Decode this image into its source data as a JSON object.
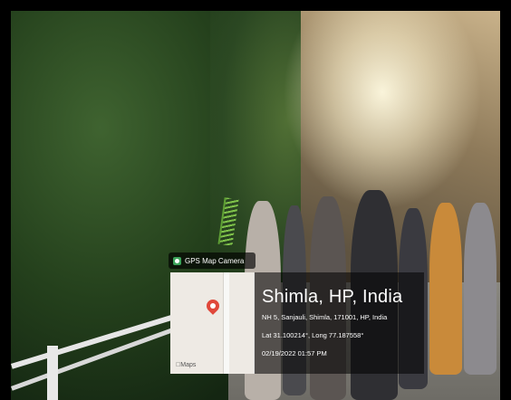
{
  "photo": {
    "description_tag": "outdoor-group-photo"
  },
  "gps_overlay": {
    "badge_label": "GPS Map Camera",
    "place": "Shimla, HP, India",
    "address": "NH 5, Sanjauli, Shimla, 171001, HP, India",
    "coords": "Lat 31.100214°, Long 77.187558°",
    "datetime": "02/19/2022 01:57 PM",
    "map_brand": "Maps"
  }
}
